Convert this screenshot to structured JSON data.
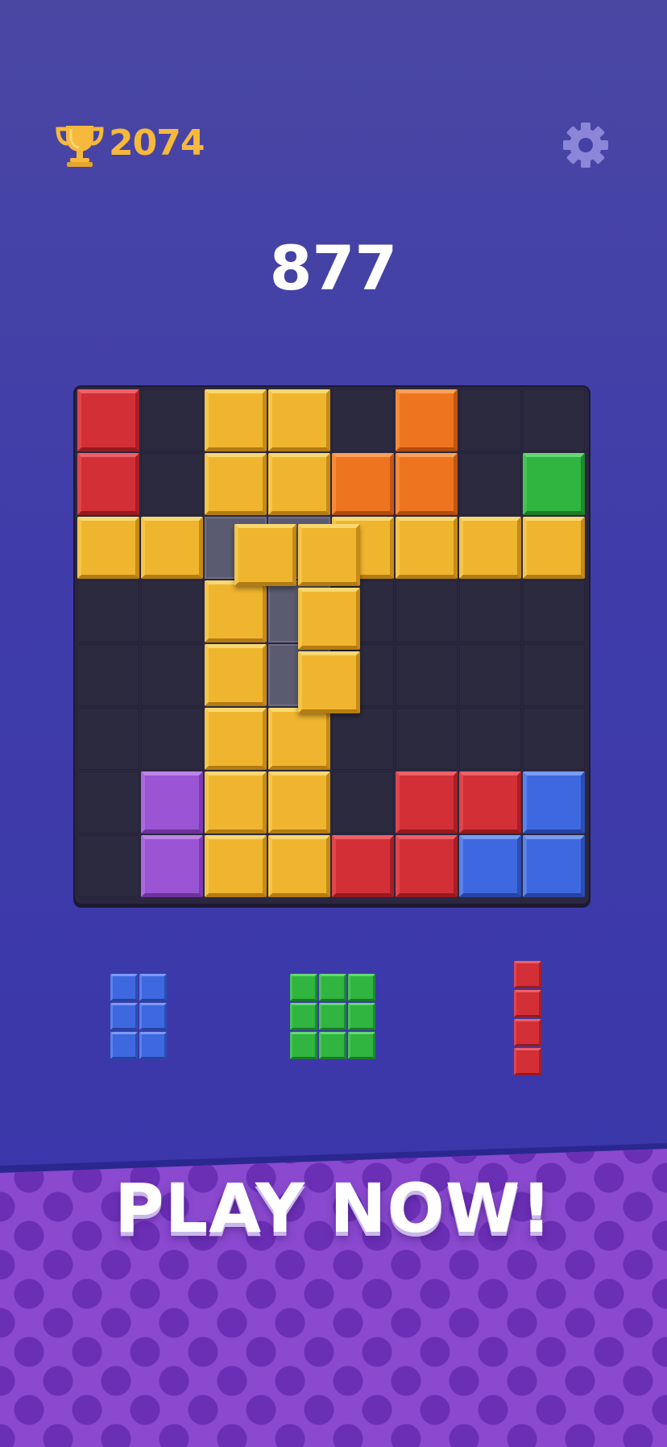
{
  "header": {
    "best_score": "2074",
    "trophy_icon": "trophy-icon",
    "settings_icon": "gear-icon"
  },
  "score": "877",
  "board": {
    "size": 8,
    "rows": [
      [
        "r",
        "-",
        "y",
        "y",
        "-",
        "o",
        "-",
        "-"
      ],
      [
        "r",
        "-",
        "y",
        "y",
        "o",
        "o",
        "-",
        "g"
      ],
      [
        "y",
        "y",
        "x",
        "x",
        "y",
        "y",
        "y",
        "y"
      ],
      [
        "-",
        "-",
        "y",
        "x",
        "-",
        "-",
        "-",
        "-"
      ],
      [
        "-",
        "-",
        "y",
        "x",
        "-",
        "-",
        "-",
        "-"
      ],
      [
        "-",
        "-",
        "y",
        "y",
        "-",
        "-",
        "-",
        "-"
      ],
      [
        "-",
        "p",
        "y",
        "y",
        "-",
        "r",
        "r",
        "b"
      ],
      [
        "-",
        "p",
        "y",
        "y",
        "r",
        "r",
        "b",
        "b"
      ]
    ],
    "legend": {
      "r": "red",
      "y": "yellow",
      "o": "orange",
      "g": "green",
      "p": "purple",
      "b": "blue",
      "x": "ghost",
      "-": "empty"
    },
    "dragged_piece": {
      "color": "yellow",
      "shape": [
        [
          1,
          1
        ],
        [
          0,
          1
        ],
        [
          0,
          1
        ]
      ]
    }
  },
  "tray": [
    {
      "name": "tray-piece-blue",
      "color": "blue",
      "shape": [
        [
          1,
          1
        ],
        [
          1,
          1
        ],
        [
          1,
          1
        ]
      ]
    },
    {
      "name": "tray-piece-green",
      "color": "green",
      "shape": [
        [
          1,
          1,
          1
        ],
        [
          1,
          1,
          1
        ],
        [
          1,
          1,
          1
        ]
      ]
    },
    {
      "name": "tray-piece-red",
      "color": "red",
      "shape": [
        [
          1
        ],
        [
          1
        ],
        [
          1
        ],
        [
          1
        ]
      ]
    }
  ],
  "colors": {
    "yellow": "#f0b52e",
    "red": "#d22f36",
    "orange": "#ef7420",
    "green": "#2fb540",
    "purple": "#9a54d4",
    "blue": "#3d68e0",
    "best_score": "#f6b93b",
    "banner": "#8a49cf"
  },
  "banner": {
    "cta": "PLAY NOW!"
  }
}
